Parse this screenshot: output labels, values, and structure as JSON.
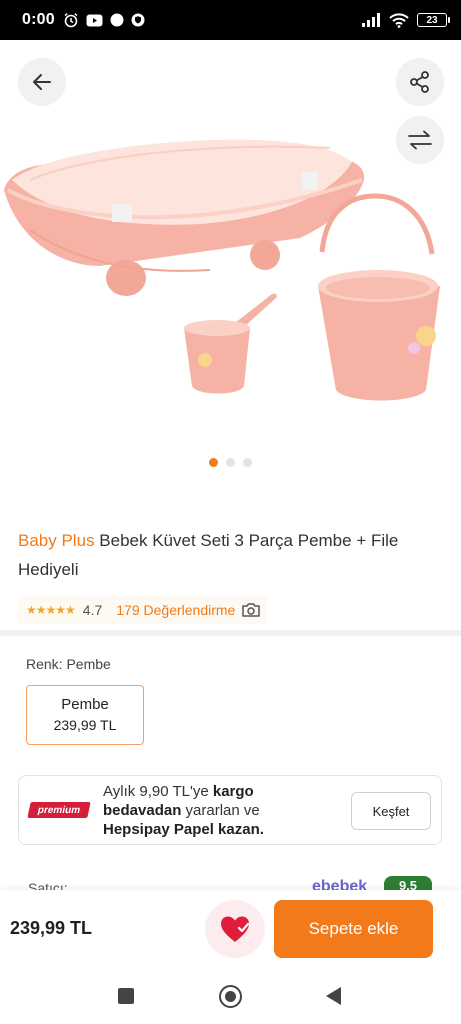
{
  "status_bar": {
    "time": "0:00",
    "battery": "23"
  },
  "gallery": {
    "page_count": 3,
    "active_index": 0
  },
  "product": {
    "brand": "Baby Plus",
    "title": "Bebek Küvet Seti 3 Parça Pembe + File Hediyeli",
    "rating": "4.7",
    "stars_icon": "★★★★★",
    "review_count_text": "179 Değerlendirme"
  },
  "variant": {
    "label": "Renk: Pembe",
    "selected_name": "Pembe",
    "selected_price": "239,99 TL"
  },
  "promo": {
    "badge": "premium",
    "line_1_pre": "Aylık 9,90 TL'ye ",
    "line_1_bold": "kargo bedavadan",
    "line_2": " yararlan ve ",
    "line_3_bold": "Hepsipay Papel kazan.",
    "button": "Keşfet"
  },
  "seller": {
    "label": "Satıcı:",
    "name": "ebebek",
    "score": "9,5"
  },
  "bottom_bar": {
    "price": "239,99 TL",
    "add_to_cart": "Sepete ekle"
  },
  "colors": {
    "accent": "#f27a1a",
    "premium": "#d41f3a",
    "product_pink": "#f6b2a4"
  }
}
